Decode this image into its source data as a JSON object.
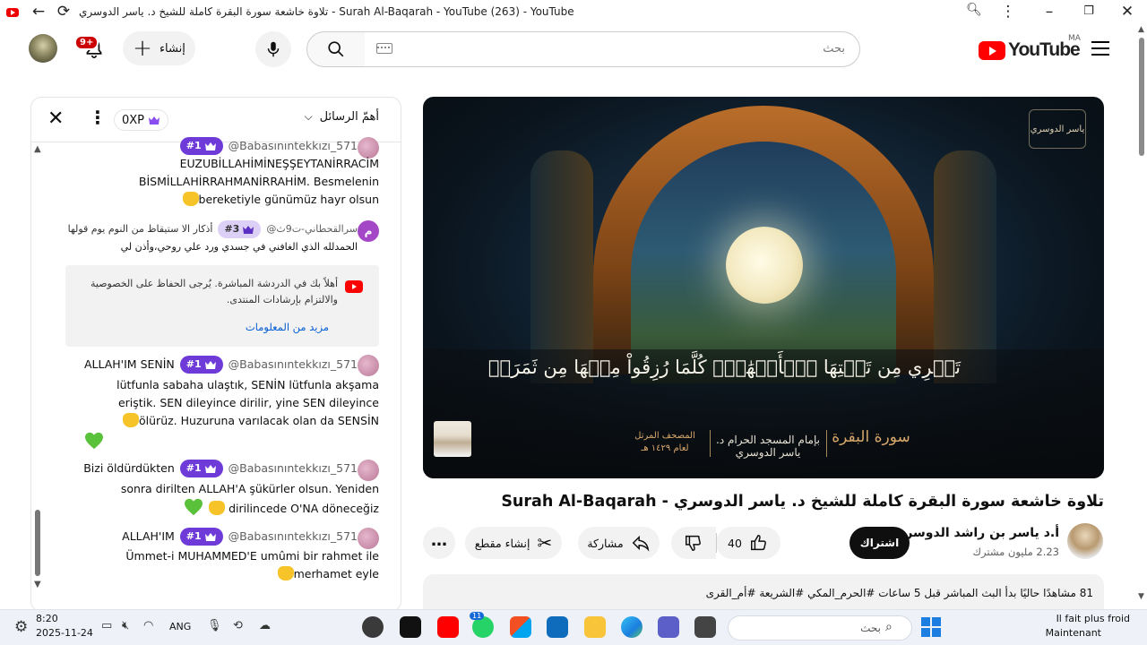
{
  "browser": {
    "window_title": "تلاوة خاشعة سورة البقرة كاملة للشيخ د. ياسر الدوسري - Surah Al-Baqarah - YouTube (263) - YouTube"
  },
  "header": {
    "notification_count": "9+",
    "create_label": "إنشاء",
    "search_placeholder": "بحث",
    "logo_text": "YouTube",
    "country_code": "MA"
  },
  "chat": {
    "mode_label": "أهمّ الرسائل",
    "xp_label": "0XP",
    "messages": [
      {
        "author": "@Babasınıntekkızı_571",
        "badge": "#1",
        "line1": "EUZUBİLLAHİMİNEŞŞEYTANİRRACİM",
        "line2": "BİSMİLLAHİRRAHMANİRRAHİM. Besmelenin",
        "line3": "bereketiyle günümüz hayr olsun"
      },
      {
        "author": "@سرالقحطاني-ت9ث",
        "badge": "#3",
        "line1": "أذكار الا ستيقاظ من النوم يوم قولها",
        "line2": "الحمدلله الذي الغافني في جسدي ورد علي روحي،وأذن لي"
      },
      {
        "author": "@Babasınıntekkızı_571",
        "badge": "#1",
        "line1": "ALLAH'IM SENİN",
        "line2": "lütfunla sabaha ulaştık, SENİN lütfunla akşama",
        "line3": "eriştik. SEN dileyince dirilir, yine SEN dileyince",
        "line4": "ölürüz. Huzuruna varılacak olan da SENSİN"
      },
      {
        "author": "@Babasınıntekkızı_571",
        "badge": "#1",
        "line1": "Bizi öldürdükten",
        "line2": "sonra dirilten ALLAH'A şükürler olsun. Yeniden",
        "line3": "dirilincede O'NA döneceğiz"
      },
      {
        "author": "@Babasınıntekkızı_571",
        "badge": "#1",
        "line1": "ALLAH'IM",
        "line2": "Ümmet-i MUHAMMED'E umûmi bir rahmet ile",
        "line3": "merhamet eyle"
      }
    ],
    "notice": {
      "text": "أهلاً بك في الدردشة المباشرة. يُرجى الحفاظ على الخصوصية والالتزام بإرشادات المنتدى.",
      "link": "مزيد من المعلومات"
    },
    "avatar_letter": "م"
  },
  "video": {
    "verse": "تَجۡرِي مِن تَحۡتِهَا ٱلۡأَنۡهَٰرُۖ كُلَّمَا رُزِقُواْ مِنۡهَا مِن ثَمَرَةٖ",
    "surah": "سورة البقرة",
    "reciter": "بإمام المسجد الحرام د. ياسر الدوسري",
    "mushaf": "المصحف المرتل لعام ١٤٢٩ هـ",
    "corner": "ياسر الدوسري"
  },
  "watch": {
    "title": "تلاوة خاشعة سورة البقرة كاملة للشيخ د. ياسر الدوسري - Surah Al-Baqarah",
    "channel_name": "أ.د ياسر بن راشد الدوسري",
    "subscribers": "2.23 مليون مشترك",
    "subscribe_label": "اشتراك",
    "like_count": "40",
    "share_label": "مشاركة",
    "clip_label": "إنشاء مقطع",
    "description": "81 مشاهدًا حاليًا  بدأ البث المباشر قبل 5 ساعات  #الحرم_المكي #الشريعة #أم_القرى"
  },
  "taskbar": {
    "time": "8:20",
    "date": "2025-11-24",
    "language": "ANG",
    "search_placeholder": "بحث",
    "weather_line1": "Il fait plus froid",
    "weather_line2": "Maintenant",
    "whatsapp_badge": "11"
  }
}
